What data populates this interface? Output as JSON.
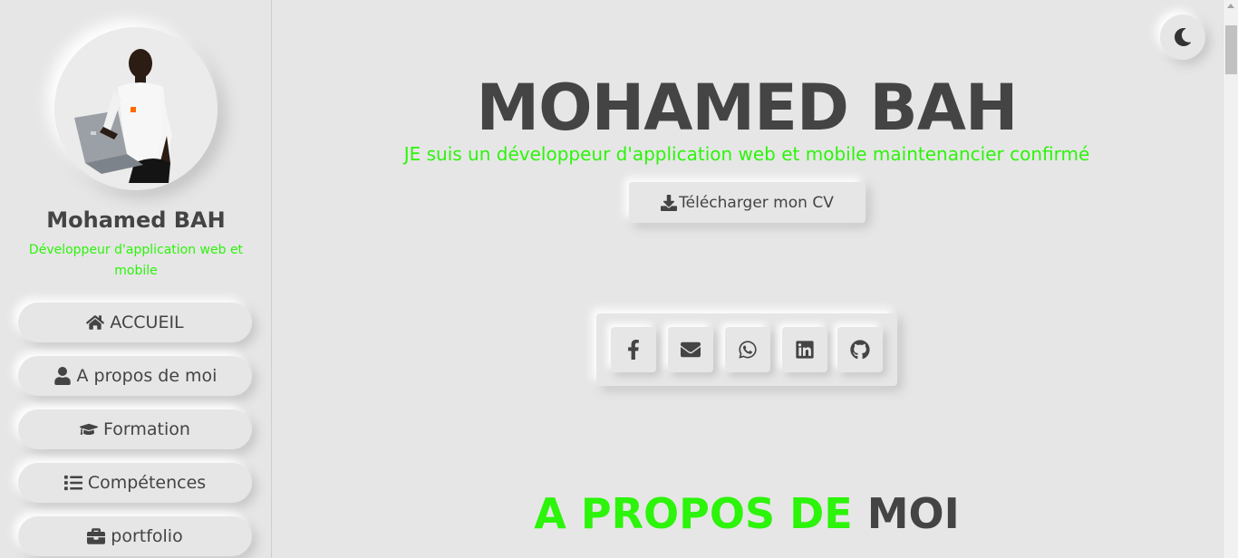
{
  "sidebar": {
    "profile_name": "Mohamed BAH",
    "profile_role": "Développeur d'application web et mobile",
    "nav": [
      {
        "label": "ACCUEIL",
        "icon": "home-icon"
      },
      {
        "label": "A propos de moi",
        "icon": "user-icon"
      },
      {
        "label": "Formation",
        "icon": "graduation-cap-icon"
      },
      {
        "label": "Compétences",
        "icon": "list-icon"
      },
      {
        "label": "portfolio",
        "icon": "briefcase-icon"
      }
    ]
  },
  "hero": {
    "title": "MOHAMED BAH",
    "subtitle": "JE suis un développeur d'application web et mobile maintenancier confirmé",
    "cv_button": "Télécharger mon CV",
    "cv_icon": "download-icon"
  },
  "social": [
    "facebook-icon",
    "envelope-icon",
    "whatsapp-icon",
    "linkedin-icon",
    "github-icon"
  ],
  "about": {
    "title_accent": "A PROPOS DE",
    "title_rest": "MOI"
  },
  "theme_toggle_icon": "moon-icon",
  "colors": {
    "accent": "#2cf40a",
    "text": "#444444",
    "background": "#e6e6e6"
  }
}
